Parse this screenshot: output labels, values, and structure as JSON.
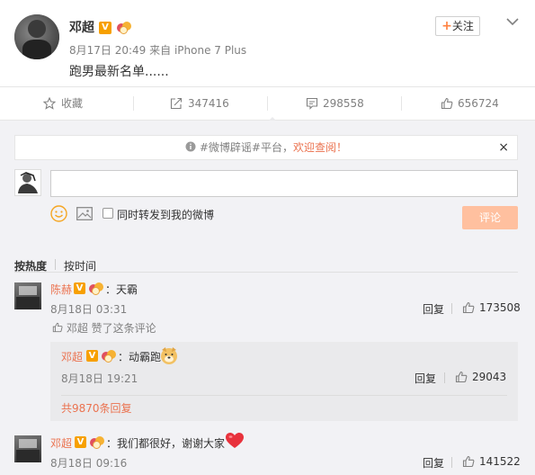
{
  "post": {
    "author": "邓超",
    "verified_badge": "V",
    "time": "8月17日 20:49",
    "source": "来自 iPhone 7 Plus",
    "text": "跑男最新名单......",
    "follow_label": "关注",
    "follow_plus": "+"
  },
  "actions": {
    "favorite_label": "收藏",
    "repost_count": "347416",
    "comment_count": "298558",
    "like_count": "656724"
  },
  "notice": {
    "tag": "#微博辟谣#平台",
    "comma": "，",
    "link": "欢迎查阅！",
    "close": "×"
  },
  "composer": {
    "repost_option": "同时转发到我的微博",
    "submit_label": "评论"
  },
  "sort": {
    "hot_label": "按热度",
    "time_label": "按时间"
  },
  "comments": [
    {
      "user": "陈赫",
      "text": "：天霸",
      "time": "8月18日 03:31",
      "reply_label": "回复",
      "likes": "173508",
      "liked_by_note": "邓超 赞了这条评论",
      "replies": [
        {
          "user": "邓超",
          "text": "：动霸跑",
          "time": "8月18日 19:21",
          "reply_label": "回复",
          "likes": "29043"
        }
      ],
      "more_replies": "共9870条回复"
    },
    {
      "user": "邓超",
      "text": "：我们都很好，谢谢大家",
      "time": "8月18日 09:16",
      "reply_label": "回复",
      "likes": "141522"
    }
  ],
  "colors": {
    "accent_orange": "#eb7350",
    "verified": "#f7a000",
    "submit_disabled": "#ffc09f"
  }
}
